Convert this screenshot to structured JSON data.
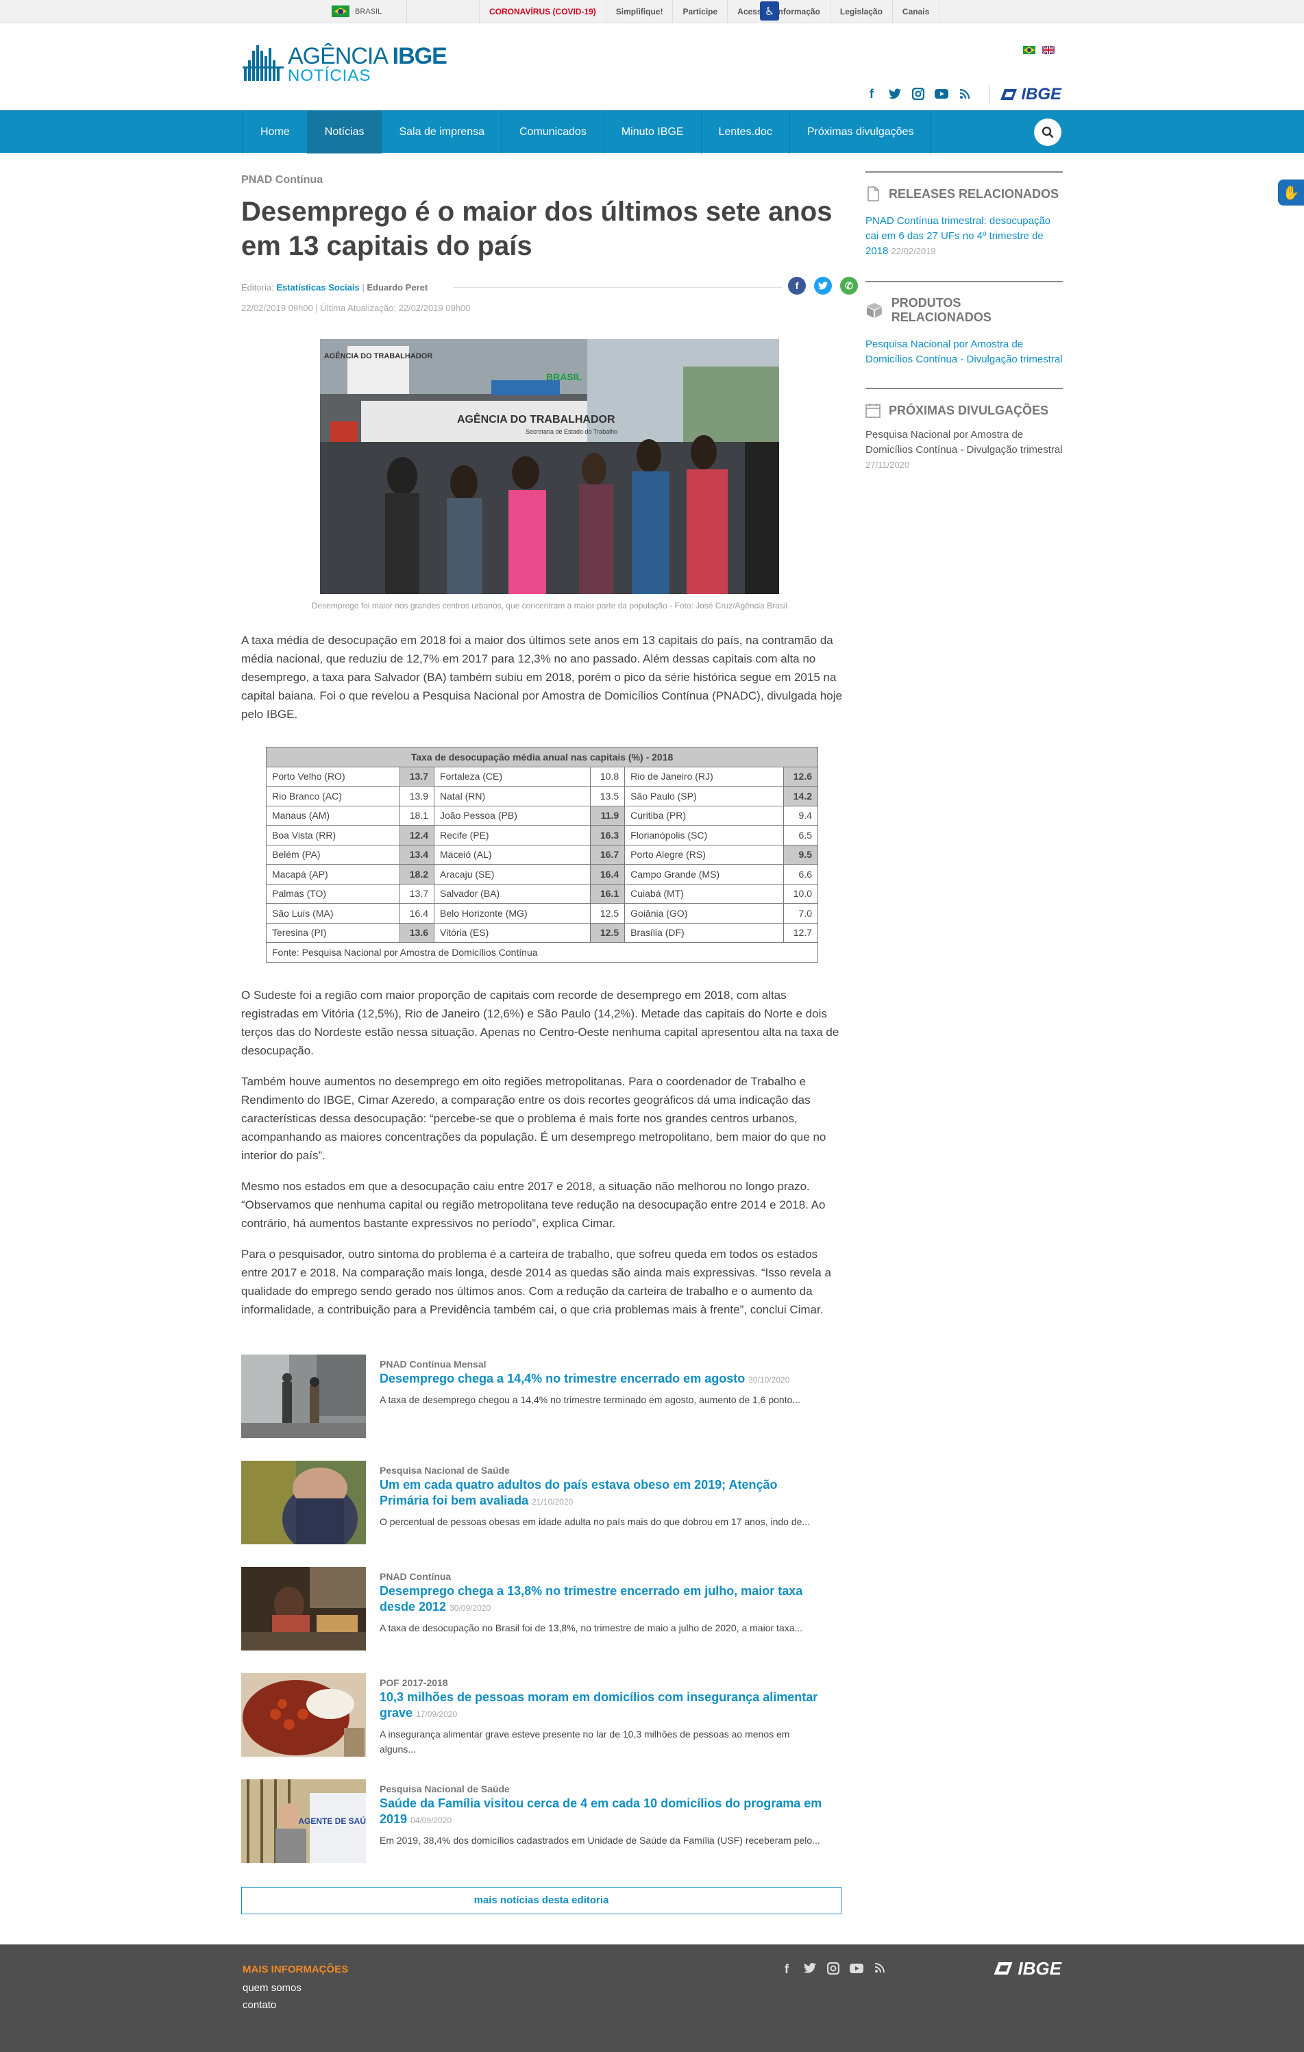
{
  "govbar": {
    "brasil": "BRASIL",
    "links": [
      "CORONAVÍRUS (COVID-19)",
      "Simplifique!",
      "Participe",
      "Acesso à informação",
      "Legislação",
      "Canais"
    ]
  },
  "header": {
    "logo_line1_a": "AGÊNCIA",
    "logo_line1_b": "IBGE",
    "logo_line2": "NOTÍCIAS",
    "brand": "IBGE"
  },
  "nav": {
    "items": [
      "Home",
      "Notícias",
      "Sala de imprensa",
      "Comunicados",
      "Minuto IBGE",
      "Lentes.doc",
      "Próximas divulgações"
    ],
    "active": "Notícias"
  },
  "article": {
    "kicker": "PNAD Contínua",
    "title": "Desemprego é o maior dos últimos sete anos em 13 capitais do país",
    "editoria_label": "Editoria:",
    "editoria": "Estatísticas Sociais",
    "author": "Eduardo Peret",
    "dates": "22/02/2019 09h00 | Última Atualização: 22/02/2019 09h00",
    "caption": "Desemprego foi maior nos grandes centros urbanos, que concentram a maior parte da população - Foto: José Cruz/Agência Brasil",
    "photo_signs": [
      "AGÊNCIA DO TRABALHADOR",
      "AGÊNCIA DO TRABALHADOR",
      "Secretaria de Estado do Trabalho",
      "BRASIL"
    ],
    "para1": "A taxa média de desocupação em 2018 foi a maior dos últimos sete anos em 13 capitais do país, na contramão da média nacional, que reduziu de 12,7% em 2017 para 12,3% no ano passado. Além dessas capitais com alta no desemprego, a taxa para Salvador (BA) também subiu em 2018, porém o pico da série histórica segue em 2015 na capital baiana. Foi o que revelou a Pesquisa Nacional por Amostra de Domicílios Contínua (PNADC), divulgada hoje pelo IBGE.",
    "para2": "O Sudeste foi a região com maior proporção de capitais com recorde de desemprego em 2018, com altas registradas em Vitória (12,5%), Rio de Janeiro (12,6%) e São Paulo (14,2%). Metade das capitais do Norte e dois terços das do Nordeste estão nessa situação. Apenas no Centro-Oeste nenhuma capital apresentou alta na taxa de desocupação.",
    "para3": "Também houve aumentos no desemprego em oito regiões metropolitanas. Para o coordenador de Trabalho e Rendimento do IBGE, Cimar Azeredo, a comparação entre os dois recortes geográficos dá uma indicação das características dessa desocupação: “percebe-se que o problema é mais forte nos grandes centros urbanos, acompanhando as maiores concentrações da população. É um desemprego metropolitano, bem maior do que no interior do país”.",
    "para4": "Mesmo nos estados em que a desocupação caiu entre 2017 e 2018, a situação não melhorou no longo prazo. “Observamos que nenhuma capital ou região metropolitana teve redução na desocupação entre 2014 e 2018. Ao contrário, há aumentos bastante expressivos no período”, explica Cimar.",
    "para5": "Para o pesquisador, outro sintoma do problema é a carteira de trabalho, que sofreu queda em todos os estados entre 2017 e 2018. Na comparação mais longa, desde 2014 as quedas são ainda mais expressivas. “Isso revela a qualidade do emprego sendo gerado nos últimos anos. Com a redução da carteira de trabalho e o aumento da informalidade, a contribuição para a Previdência também cai, o que cria problemas mais à frente”, conclui Cimar."
  },
  "table": {
    "title": "Taxa de desocupação média anual nas capitais (%) - 2018",
    "rows": [
      [
        [
          "Porto Velho (RO)",
          "13.7",
          true
        ],
        [
          "Fortaleza (CE)",
          "10.8",
          false
        ],
        [
          "Rio de Janeiro (RJ)",
          "12.6",
          true
        ]
      ],
      [
        [
          "Rio Branco (AC)",
          "13.9",
          false
        ],
        [
          "Natal (RN)",
          "13.5",
          false
        ],
        [
          "São Paulo (SP)",
          "14.2",
          true
        ]
      ],
      [
        [
          "Manaus (AM)",
          "18.1",
          false
        ],
        [
          "João Pessoa (PB)",
          "11.9",
          true
        ],
        [
          "Curitiba (PR)",
          "9.4",
          false
        ]
      ],
      [
        [
          "Boa Vista (RR)",
          "12.4",
          true
        ],
        [
          "Recife (PE)",
          "16.3",
          true
        ],
        [
          "Florianópolis (SC)",
          "6.5",
          false
        ]
      ],
      [
        [
          "Belém (PA)",
          "13.4",
          true
        ],
        [
          "Maceió (AL)",
          "16.7",
          true
        ],
        [
          "Porto Alegre (RS)",
          "9.5",
          true
        ]
      ],
      [
        [
          "Macapá (AP)",
          "18.2",
          true
        ],
        [
          "Aracaju (SE)",
          "16.4",
          true
        ],
        [
          "Campo Grande (MS)",
          "6.6",
          false
        ]
      ],
      [
        [
          "Palmas (TO)",
          "13.7",
          false
        ],
        [
          "Salvador (BA)",
          "16.1",
          true
        ],
        [
          "Cuiabá (MT)",
          "10.0",
          false
        ]
      ],
      [
        [
          "São Luís (MA)",
          "16.4",
          false
        ],
        [
          "Belo Horizonte (MG)",
          "12.5",
          false
        ],
        [
          "Goiânia (GO)",
          "7.0",
          false
        ]
      ],
      [
        [
          "Teresina (PI)",
          "13.6",
          true
        ],
        [
          "Vitória (ES)",
          "12.5",
          true
        ],
        [
          "Brasília (DF)",
          "12.7",
          false
        ]
      ]
    ],
    "source": "Fonte: Pesquisa Nacional por Amostra de Domicílios Contínua"
  },
  "related": [
    {
      "cat": "PNAD Contínua Mensal",
      "title": "Desemprego chega a 14,4% no trimestre encerrado em agosto",
      "date": "30/10/2020",
      "desc": "A taxa de desemprego chegou a 14,4% no trimestre terminado em agosto, aumento de 1,6 ponto..."
    },
    {
      "cat": "Pesquisa Nacional de Saúde",
      "title": "Um em cada quatro adultos do país estava obeso em 2019; Atenção Primária foi bem avaliada",
      "date": "21/10/2020",
      "desc": "O percentual de pessoas obesas em idade adulta no país mais do que dobrou em 17 anos, indo de..."
    },
    {
      "cat": "PNAD Contínua",
      "title": "Desemprego chega a 13,8% no trimestre encerrado em julho, maior taxa desde 2012",
      "date": "30/09/2020",
      "desc": "A taxa de desocupação no Brasil foi de 13,8%, no trimestre de maio a julho de 2020, a maior taxa..."
    },
    {
      "cat": "POF 2017-2018",
      "title": "10,3 milhões de pessoas moram em domicílios com insegurança alimentar grave",
      "date": "17/09/2020",
      "desc": "A insegurança alimentar grave esteve presente no lar de 10,3 milhões de pessoas ao menos em alguns..."
    },
    {
      "cat": "Pesquisa Nacional de Saúde",
      "title": "Saúde da Família visitou cerca de 4 em cada 10 domicílios do programa em 2019",
      "date": "04/09/2020",
      "desc": "Em 2019, 38,4% dos domicílios cadastrados em Unidade de Saúde da Família (USF) receberam pelo..."
    }
  ],
  "related_thumb_text": "AGENTE DE SAÚDE",
  "more_button": "mais notícias desta editoria",
  "sidebar": {
    "releases_title": "RELEASES RELACIONADOS",
    "releases_link": "PNAD Contínua trimestral: desocupação cai em 6 das 27 UFs no 4º trimestre de 2018",
    "releases_date": "22/02/2019",
    "produtos_title": "PRODUTOS RELACIONADOS",
    "produtos_link": "Pesquisa Nacional por Amostra de Domicílios Contínua - Divulgação trimestral",
    "proximas_title": "PRÓXIMAS DIVULGAÇÕES",
    "proximas_text": "Pesquisa Nacional por Amostra de Domicílios Contínua - Divulgação trimestral",
    "proximas_date": "27/11/2020"
  },
  "footer": {
    "heading": "MAIS INFORMAÇÕES",
    "link1": "quem somos",
    "link2": "contato",
    "brand": "IBGE"
  },
  "colors": {
    "primary": "#0f8ec2",
    "nav_active": "#1576a0",
    "footer_bg": "#4f4f4f",
    "covid_red": "#d0021b",
    "footer_heading": "#f08a24"
  }
}
